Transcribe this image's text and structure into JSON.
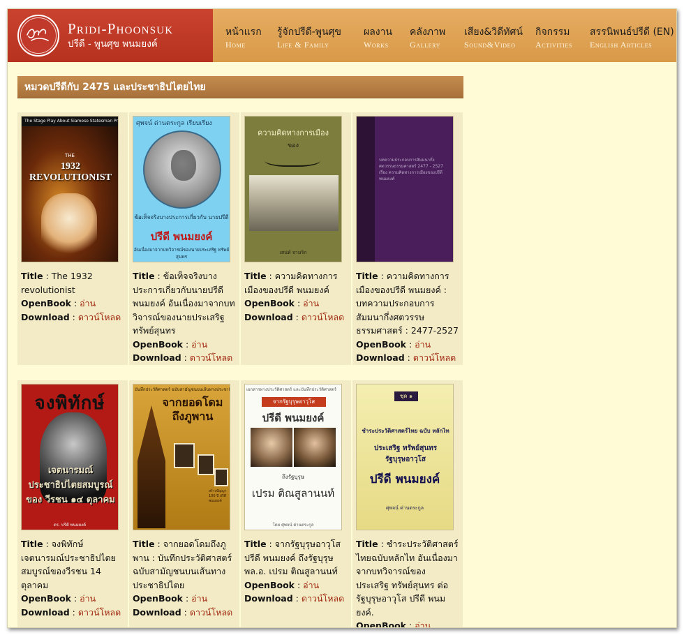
{
  "brand": {
    "name_en": "Pridi-Phoonsuk",
    "name_th": "ปรีดี - พูนศุข พนมยงค์"
  },
  "nav": [
    {
      "th": "หน้าแรก",
      "en": "Home"
    },
    {
      "th": "รู้จักปรีดี-พูนศุข",
      "en": "Life & Family"
    },
    {
      "th": "ผลงาน",
      "en": "Works"
    },
    {
      "th": "คลังภาพ",
      "en": "Gallery"
    },
    {
      "th": "เสียง&วิดีทัศน์",
      "en": "Sound&Video"
    },
    {
      "th": "กิจกรรม",
      "en": "Activities"
    },
    {
      "th": "สรรนิพนธ์ปรีดี (EN)",
      "en": "English Articles"
    }
  ],
  "category_title": "หมวดปรีดีกับ 2475 และประชาธิปไตยไทย",
  "labels": {
    "title": "Title",
    "openbook": "OpenBook",
    "download": "Download",
    "open_link": "อ่าน",
    "download_link": "ดาวน์โหลด"
  },
  "books": [
    {
      "title": "The 1932 revolutionist",
      "cover": {
        "band": "The Stage Play About Siamese Statesman Pridi Banomyong",
        "small": "THE",
        "title": "1932 REVOLUTIONIST"
      }
    },
    {
      "title": "ข้อเท็จจริงบางประการเกี่ยวกับนายปรีดี พนมยงค์ อันเนื่องมาจากบทวิจารณ์ของนายประเสริฐ ทรัพย์สุนทร",
      "cover": {
        "top": "ศุพจน์ ด่านตระกูล  เรียบเรียง",
        "sub": "ข้อเท็จจริงบางประการเกี่ยวกับ นายปรีดี",
        "name": "ปรีดี พนมยงค์",
        "foot": "อันเนื่องมาจากบทวิจารณ์ของนายประเสริฐ ทรัพย์สุนทร"
      }
    },
    {
      "title": "ความคิดทางการเมืองของปรีดี พนมยงค์",
      "cover": {
        "title": "ความคิดทางการเมือง",
        "sub": "ของ",
        "foot": "เสน่ห์ จามริก"
      }
    },
    {
      "title": "ความคิดทางการเมืองของปรีดี พนมยงค์ : บทความประกอบการสัมมนากึ่งศตวรรษธรรมศาสตร์ : 2477-2527",
      "cover": {
        "text": "บทความประกอบการสัมมนากึ่งศตวรรษธรรมศาสตร์ 2477 - 2527 เรื่อง ความคิดทางการเมืองของปรีดี พนมยงค์"
      }
    },
    {
      "title": "จงพิทักษ์เจตนารมณ์ประชาธิปไตยสมบูรณ์ของวีรชน 14 ตุลาคม",
      "cover": {
        "big": "จงพิทักษ์",
        "band": "เจตนารมณ์ ประชาธิปไตยสมบูรณ์ ของ วีรชน ๑๔ ตุลาคม",
        "foot": "ดร. ปรีดี พนมยงค์"
      }
    },
    {
      "title": "จากยอดโดมถึงภูพาน : บันทึกประวัติศาสตร์ฉบับสามัญชนบนเส้นทางประชาธิปไตย",
      "cover": {
        "top": "บันทึกประวัติศาสตร์ ฉบับสามัญชนบนเส้นทางประชาธิปไตย",
        "title": "จากยอดโดม ถึงภูพาน",
        "side": "สร้างปัญญา 100 ปี ปรีดี พนมยงค์"
      }
    },
    {
      "title": "จากรัฐบุรุษอาวุโสปรีดี พนมยงค์ ถึงรัฐบุรุษ พล.อ. เปรม ติณสูลานนท์",
      "cover": {
        "top": "เอกสารทางประวัติศาสตร์ และบันทึกประวัติศาสตร์",
        "bar": "จากรัฐบุรุษอาวุโส",
        "name1": "ปรีดี พนมยงค์",
        "mid": "ถึงรัฐบุรุษ",
        "name2": "เปรม ติณสูลานนท์",
        "foot": "โดย ศุพจน์ ด่านตระกูล"
      }
    },
    {
      "title": "ชำระประวัติศาสตร์ไทยฉบับหลักไท อันเนื่องมาจากบทวิจารณ์ของ ประเสริฐ ทรัพย์สุนทร ต่อ รัฐบุรุษอาวุโส ปรีดี พนมยงค์.",
      "cover": {
        "no": "ชุด ๑",
        "l1": "ชำระประวัติศาสตร์ไทย ฉบับ หลักไท",
        "l2": "ประเสริฐ ทรัพย์สุนทร",
        "l3": "รัฐบุรุษอาวุโส",
        "l4": "ปรีดี พนมยงค์",
        "foot": "ศุพจน์ ด่านตระกูล"
      }
    }
  ],
  "colors": {
    "brand_red": "#c0392b",
    "nav_orange": "#e0a452",
    "page_bg": "#fefbd6",
    "card_bg": "#f3ebc6",
    "link": "#a02a12"
  }
}
